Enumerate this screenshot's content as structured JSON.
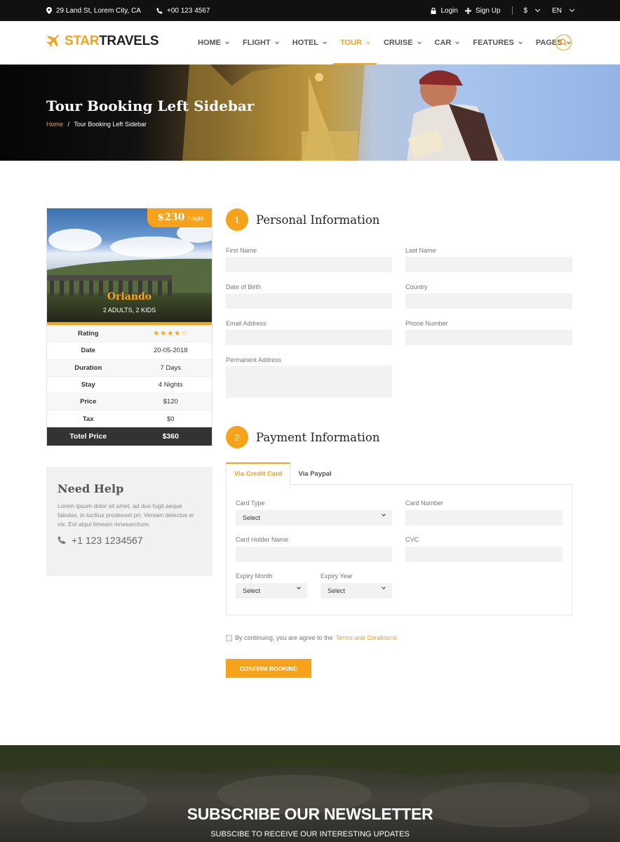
{
  "topbar": {
    "address": "29 Land St, Lorem City, CA",
    "phone": "+00 123 4567",
    "login": "Login",
    "signup": "Sign Up",
    "currency": "$",
    "language": "EN"
  },
  "logo": {
    "part1": "STAR",
    "part2": "TRAVELS"
  },
  "nav": {
    "items": [
      {
        "label": "HOME"
      },
      {
        "label": "FLIGHT"
      },
      {
        "label": "HOTEL"
      },
      {
        "label": "TOUR"
      },
      {
        "label": "CRUISE"
      },
      {
        "label": "CAR"
      },
      {
        "label": "FEATURES"
      },
      {
        "label": "PAGES"
      }
    ],
    "active": "TOUR"
  },
  "hero": {
    "title": "Tour Booking Left Sidebar",
    "breadcrumb_home": "Home",
    "breadcrumb_sep": "/",
    "breadcrumb_current": "Tour Booking Left Sidebar"
  },
  "summary": {
    "price": "$230",
    "price_unit": "/ night",
    "city": "Orlando",
    "guests": "2 ADULTS, 2 KIDS",
    "rating_label": "Rating",
    "rating": 4,
    "rating_max": 5,
    "rows": [
      {
        "label": "Date",
        "value": "20-05-2018"
      },
      {
        "label": "Duration",
        "value": "7 Days"
      },
      {
        "label": "Stay",
        "value": "4 Nights"
      },
      {
        "label": "Price",
        "value": "$120"
      },
      {
        "label": "Tax",
        "value": "$0"
      }
    ],
    "total_label": "Totel Price",
    "total_value": "$360"
  },
  "help": {
    "title": "Need Help",
    "text": "Lorem ipsum dolor sit amet, ad duo fugit aeque fabulas, in lucilius prodesset pri. Veniam delectus ei vis. Est atqui timeam mnesarchum.",
    "phone": "+1 123 1234567"
  },
  "personal": {
    "step": "1",
    "title": "Personal Information",
    "first_name": "First Name",
    "last_name": "Last Name",
    "dob": "Date of Birth",
    "country": "Country",
    "email": "Email Address",
    "phone": "Phone Number",
    "address": "Permanent Address"
  },
  "payment": {
    "step": "2",
    "title": "Payment Information",
    "tab_card": "Via Credit Card",
    "tab_paypal": "Via Paypal",
    "card_type": "Card Type",
    "card_type_value": "Select",
    "card_number": "Card Number",
    "holder_name": "Card Holder Name",
    "cvc": "CVC",
    "expiry_month": "Expiry Month",
    "expiry_month_value": "Select",
    "expiry_year": "Expiry Year",
    "expiry_year_value": "Select"
  },
  "agreement": {
    "text": "By continuing, you are agree to the",
    "link": "Terms and Conditions."
  },
  "confirm_label": "CONFIRM BOOKING",
  "newsletter": {
    "title": "SUBSCRIBE OUR NEWSLETTER",
    "subtitle": "SUBSCIBE TO RECEIVE OUR INTERESTING UPDATES"
  },
  "colors": {
    "accent": "#f7a21b",
    "dark": "#111111",
    "panel": "#f2f2f2"
  }
}
